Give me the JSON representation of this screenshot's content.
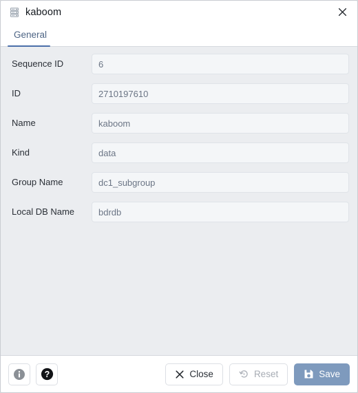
{
  "window": {
    "title": "kaboom",
    "title_icon": "database-stack-icon",
    "close_icon": "close-icon"
  },
  "tabs": [
    {
      "label": "General",
      "active": true
    }
  ],
  "form": {
    "fields": [
      {
        "label": "Sequence ID",
        "value": "6"
      },
      {
        "label": "ID",
        "value": "2710197610"
      },
      {
        "label": "Name",
        "value": "kaboom"
      },
      {
        "label": "Kind",
        "value": "data"
      },
      {
        "label": "Group Name",
        "value": "dc1_subgroup"
      },
      {
        "label": "Local DB Name",
        "value": "bdrdb"
      }
    ]
  },
  "footer": {
    "info_icon": "info-icon",
    "help_icon": "help-icon",
    "buttons": [
      {
        "label": "Close",
        "icon": "close-x-icon",
        "style": "default"
      },
      {
        "label": "Reset",
        "icon": "reset-undo-icon",
        "style": "muted"
      },
      {
        "label": "Save",
        "icon": "save-floppy-icon",
        "style": "primary"
      }
    ]
  },
  "colors": {
    "accent": "#4a6ea9",
    "tab_active_text": "#4e6585",
    "primary_button": "#7e9abd",
    "body_background": "#ebedf0",
    "input_background": "#f4f6f8",
    "input_text": "#6b7585"
  }
}
